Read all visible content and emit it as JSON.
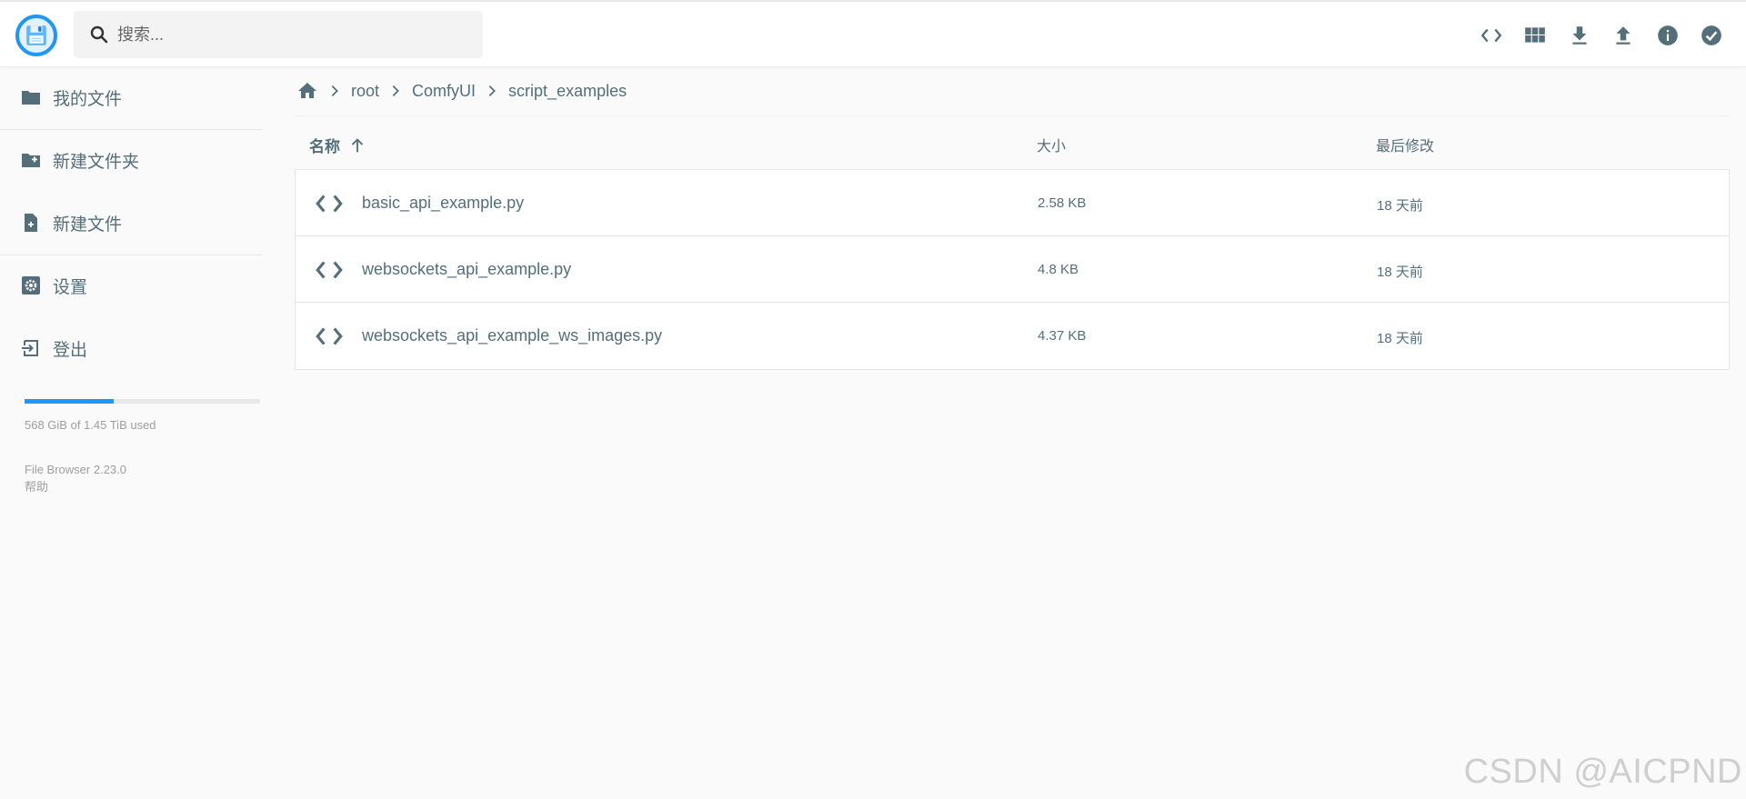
{
  "search": {
    "placeholder": "搜索..."
  },
  "topbar": {
    "actions": [
      {
        "name": "code-icon"
      },
      {
        "name": "grid-view-icon"
      },
      {
        "name": "download-icon"
      },
      {
        "name": "upload-icon"
      },
      {
        "name": "info-icon"
      },
      {
        "name": "check-circle-icon"
      }
    ]
  },
  "sidebar": {
    "items": [
      {
        "label": "我的文件",
        "icon": "folder-icon"
      },
      {
        "label": "新建文件夹",
        "icon": "new-folder-icon"
      },
      {
        "label": "新建文件",
        "icon": "new-file-icon"
      },
      {
        "label": "设置",
        "icon": "settings-icon"
      },
      {
        "label": "登出",
        "icon": "logout-icon"
      }
    ],
    "usage": {
      "text": "568 GiB of 1.45 TiB used",
      "fraction": 0.38
    },
    "version": "File Browser 2.23.0",
    "help": "帮助"
  },
  "breadcrumb": {
    "items": [
      "root",
      "ComfyUI",
      "script_examples"
    ]
  },
  "table": {
    "headers": {
      "name": "名称",
      "size": "大小",
      "modified": "最后修改"
    },
    "rows": [
      {
        "name": "basic_api_example.py",
        "size": "2.58 KB",
        "modified": "18 天前"
      },
      {
        "name": "websockets_api_example.py",
        "size": "4.8 KB",
        "modified": "18 天前"
      },
      {
        "name": "websockets_api_example_ws_images.py",
        "size": "4.37 KB",
        "modified": "18 天前"
      }
    ]
  },
  "watermark": "CSDN @AICPND",
  "colors": {
    "accent": "#2196f3",
    "icon": "#546e7a",
    "text": "#546e7a"
  }
}
